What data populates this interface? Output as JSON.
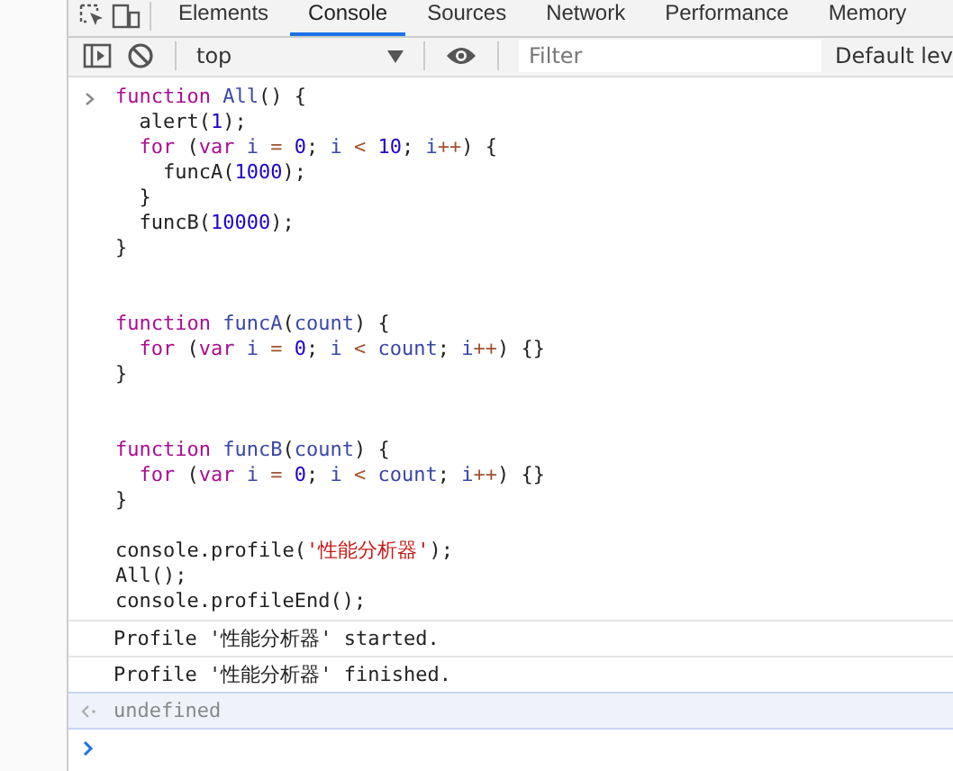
{
  "tabs": [
    {
      "label": "Elements",
      "selected": false
    },
    {
      "label": "Console",
      "selected": true
    },
    {
      "label": "Sources",
      "selected": false
    },
    {
      "label": "Network",
      "selected": false
    },
    {
      "label": "Performance",
      "selected": false
    },
    {
      "label": "Memory",
      "selected": false
    }
  ],
  "toolbar": {
    "context": "top",
    "filter": {
      "placeholder": "Filter"
    },
    "levels": "Default lev"
  },
  "input": [
    {
      "kind": "code",
      "tokens": [
        {
          "kind": "keyword",
          "text": "function "
        },
        {
          "kind": "name",
          "text": "All"
        },
        {
          "kind": "plain",
          "text": "() {"
        }
      ]
    },
    {
      "kind": "code",
      "tokens": [
        {
          "kind": "plain",
          "text": "  alert("
        },
        {
          "kind": "number",
          "text": "1"
        },
        {
          "kind": "plain",
          "text": ");"
        }
      ]
    },
    {
      "kind": "code",
      "tokens": [
        {
          "kind": "keyword",
          "text": "  for"
        },
        {
          "kind": "plain",
          "text": " ("
        },
        {
          "kind": "keyword",
          "text": "var "
        },
        {
          "kind": "name",
          "text": "i "
        },
        {
          "kind": "operator",
          "text": "= "
        },
        {
          "kind": "number",
          "text": "0"
        },
        {
          "kind": "plain",
          "text": "; "
        },
        {
          "kind": "name",
          "text": "i "
        },
        {
          "kind": "operator",
          "text": "< "
        },
        {
          "kind": "number",
          "text": "10"
        },
        {
          "kind": "plain",
          "text": "; "
        },
        {
          "kind": "name",
          "text": "i"
        },
        {
          "kind": "operator",
          "text": "++"
        },
        {
          "kind": "plain",
          "text": ") {"
        }
      ]
    },
    {
      "kind": "code",
      "tokens": [
        {
          "kind": "plain",
          "text": "    funcA("
        },
        {
          "kind": "number",
          "text": "1000"
        },
        {
          "kind": "plain",
          "text": ");"
        }
      ]
    },
    {
      "kind": "code",
      "tokens": [
        {
          "kind": "plain",
          "text": "  }"
        }
      ]
    },
    {
      "kind": "code",
      "tokens": [
        {
          "kind": "plain",
          "text": "  funcB("
        },
        {
          "kind": "number",
          "text": "10000"
        },
        {
          "kind": "plain",
          "text": ");"
        }
      ]
    },
    {
      "kind": "code",
      "tokens": [
        {
          "kind": "plain",
          "text": "}"
        }
      ]
    },
    {
      "kind": "blank"
    },
    {
      "kind": "blank"
    },
    {
      "kind": "code",
      "tokens": [
        {
          "kind": "keyword",
          "text": "function "
        },
        {
          "kind": "name",
          "text": "funcA"
        },
        {
          "kind": "plain",
          "text": "("
        },
        {
          "kind": "name",
          "text": "count"
        },
        {
          "kind": "plain",
          "text": ") {"
        }
      ]
    },
    {
      "kind": "code",
      "tokens": [
        {
          "kind": "keyword",
          "text": "  for"
        },
        {
          "kind": "plain",
          "text": " ("
        },
        {
          "kind": "keyword",
          "text": "var "
        },
        {
          "kind": "name",
          "text": "i "
        },
        {
          "kind": "operator",
          "text": "= "
        },
        {
          "kind": "number",
          "text": "0"
        },
        {
          "kind": "plain",
          "text": "; "
        },
        {
          "kind": "name",
          "text": "i "
        },
        {
          "kind": "operator",
          "text": "< "
        },
        {
          "kind": "name",
          "text": "count"
        },
        {
          "kind": "plain",
          "text": "; "
        },
        {
          "kind": "name",
          "text": "i"
        },
        {
          "kind": "operator",
          "text": "++"
        },
        {
          "kind": "plain",
          "text": ") {}"
        }
      ]
    },
    {
      "kind": "code",
      "tokens": [
        {
          "kind": "plain",
          "text": "}"
        }
      ]
    },
    {
      "kind": "blank"
    },
    {
      "kind": "blank"
    },
    {
      "kind": "code",
      "tokens": [
        {
          "kind": "keyword",
          "text": "function "
        },
        {
          "kind": "name",
          "text": "funcB"
        },
        {
          "kind": "plain",
          "text": "("
        },
        {
          "kind": "name",
          "text": "count"
        },
        {
          "kind": "plain",
          "text": ") {"
        }
      ]
    },
    {
      "kind": "code",
      "tokens": [
        {
          "kind": "keyword",
          "text": "  for"
        },
        {
          "kind": "plain",
          "text": " ("
        },
        {
          "kind": "keyword",
          "text": "var "
        },
        {
          "kind": "name",
          "text": "i "
        },
        {
          "kind": "operator",
          "text": "= "
        },
        {
          "kind": "number",
          "text": "0"
        },
        {
          "kind": "plain",
          "text": "; "
        },
        {
          "kind": "name",
          "text": "i "
        },
        {
          "kind": "operator",
          "text": "< "
        },
        {
          "kind": "name",
          "text": "count"
        },
        {
          "kind": "plain",
          "text": "; "
        },
        {
          "kind": "name",
          "text": "i"
        },
        {
          "kind": "operator",
          "text": "++"
        },
        {
          "kind": "plain",
          "text": ") {}"
        }
      ]
    },
    {
      "kind": "code",
      "tokens": [
        {
          "kind": "plain",
          "text": "}"
        }
      ]
    },
    {
      "kind": "blank"
    },
    {
      "kind": "code",
      "tokens": [
        {
          "kind": "plain",
          "text": "console.profile("
        },
        {
          "kind": "string",
          "text": "'性能分析器'"
        },
        {
          "kind": "plain",
          "text": ");"
        }
      ]
    },
    {
      "kind": "code",
      "tokens": [
        {
          "kind": "plain",
          "text": "All();"
        }
      ]
    },
    {
      "kind": "code",
      "tokens": [
        {
          "kind": "plain",
          "text": "console.profileEnd();"
        }
      ]
    }
  ],
  "messages": [
    "Profile '性能分析器' started.",
    "Profile '性能分析器' finished."
  ],
  "result": "undefined"
}
